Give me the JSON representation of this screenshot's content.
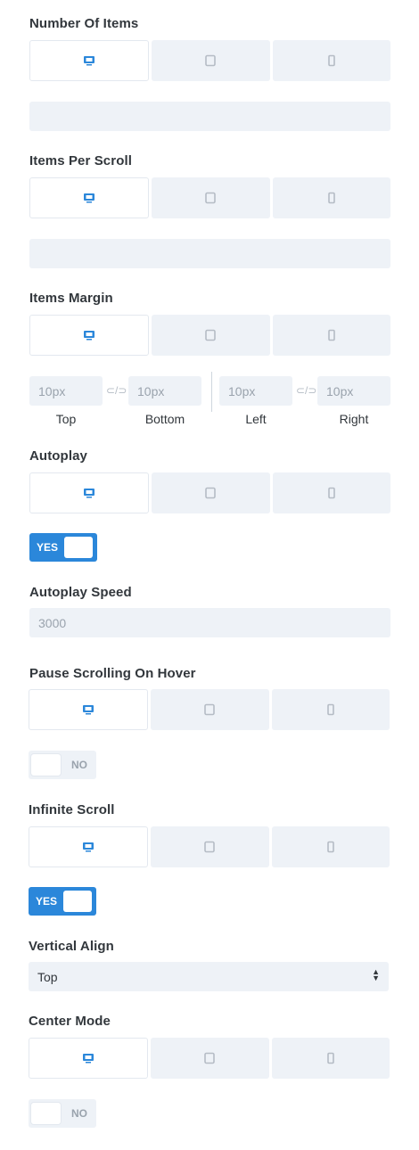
{
  "labels": {
    "number_of_items": "Number Of Items",
    "items_per_scroll": "Items Per Scroll",
    "items_margin": "Items Margin",
    "autoplay": "Autoplay",
    "autoplay_speed": "Autoplay Speed",
    "pause_on_hover": "Pause Scrolling On Hover",
    "infinite_scroll": "Infinite Scroll",
    "vertical_align": "Vertical Align",
    "center_mode": "Center Mode"
  },
  "device_icons": [
    "desktop-icon",
    "tablet-icon",
    "phone-icon"
  ],
  "colors": {
    "accent": "#2b87da",
    "field_bg": "#eef2f7",
    "text": "#32373c",
    "placeholder": "#9aa3ad"
  },
  "margin": {
    "top_value": "10px",
    "bottom_value": "10px",
    "left_value": "10px",
    "right_value": "10px",
    "top_label": "Top",
    "bottom_label": "Bottom",
    "left_label": "Left",
    "right_label": "Right",
    "link_glyph": "⊂/⊃"
  },
  "autoplay_toggle": "YES",
  "autoplay_speed_value": "3000",
  "pause_toggle": "NO",
  "infinite_toggle": "YES",
  "vertical_align_value": "Top",
  "center_toggle": "NO"
}
